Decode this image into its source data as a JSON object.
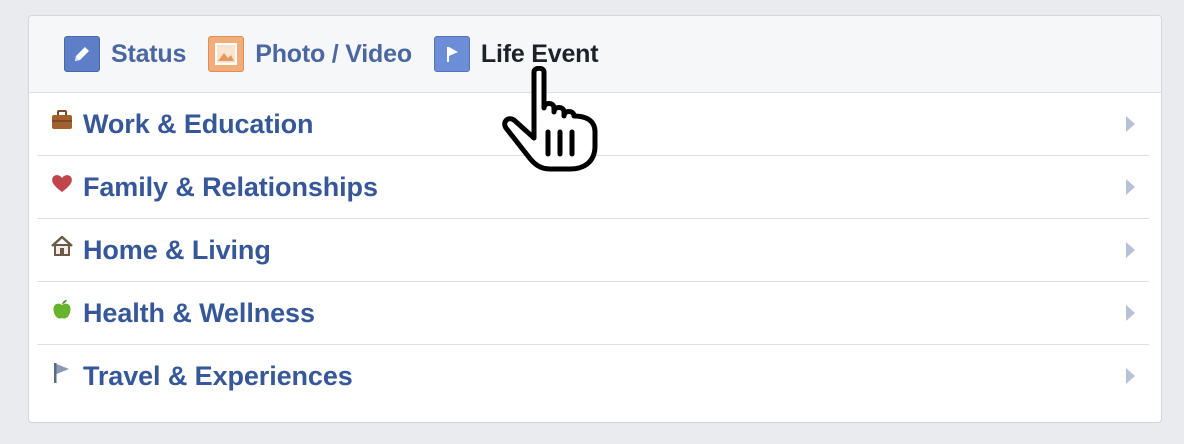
{
  "composer": {
    "tabs": [
      {
        "label": "Status",
        "icon": "pencil-icon"
      },
      {
        "label": "Photo / Video",
        "icon": "photo-icon"
      },
      {
        "label": "Life Event",
        "icon": "flag-icon"
      }
    ]
  },
  "life_events": {
    "items": [
      {
        "label": "Work & Education",
        "icon": "briefcase-icon"
      },
      {
        "label": "Family & Relationships",
        "icon": "heart-icon"
      },
      {
        "label": "Home & Living",
        "icon": "house-icon"
      },
      {
        "label": "Health & Wellness",
        "icon": "apple-icon"
      },
      {
        "label": "Travel & Experiences",
        "icon": "flag-icon"
      }
    ]
  },
  "colors": {
    "link_blue": "#365899",
    "tab_blue": "#4b67a1",
    "active_text": "#1d2129",
    "background": "#e9ebee"
  }
}
